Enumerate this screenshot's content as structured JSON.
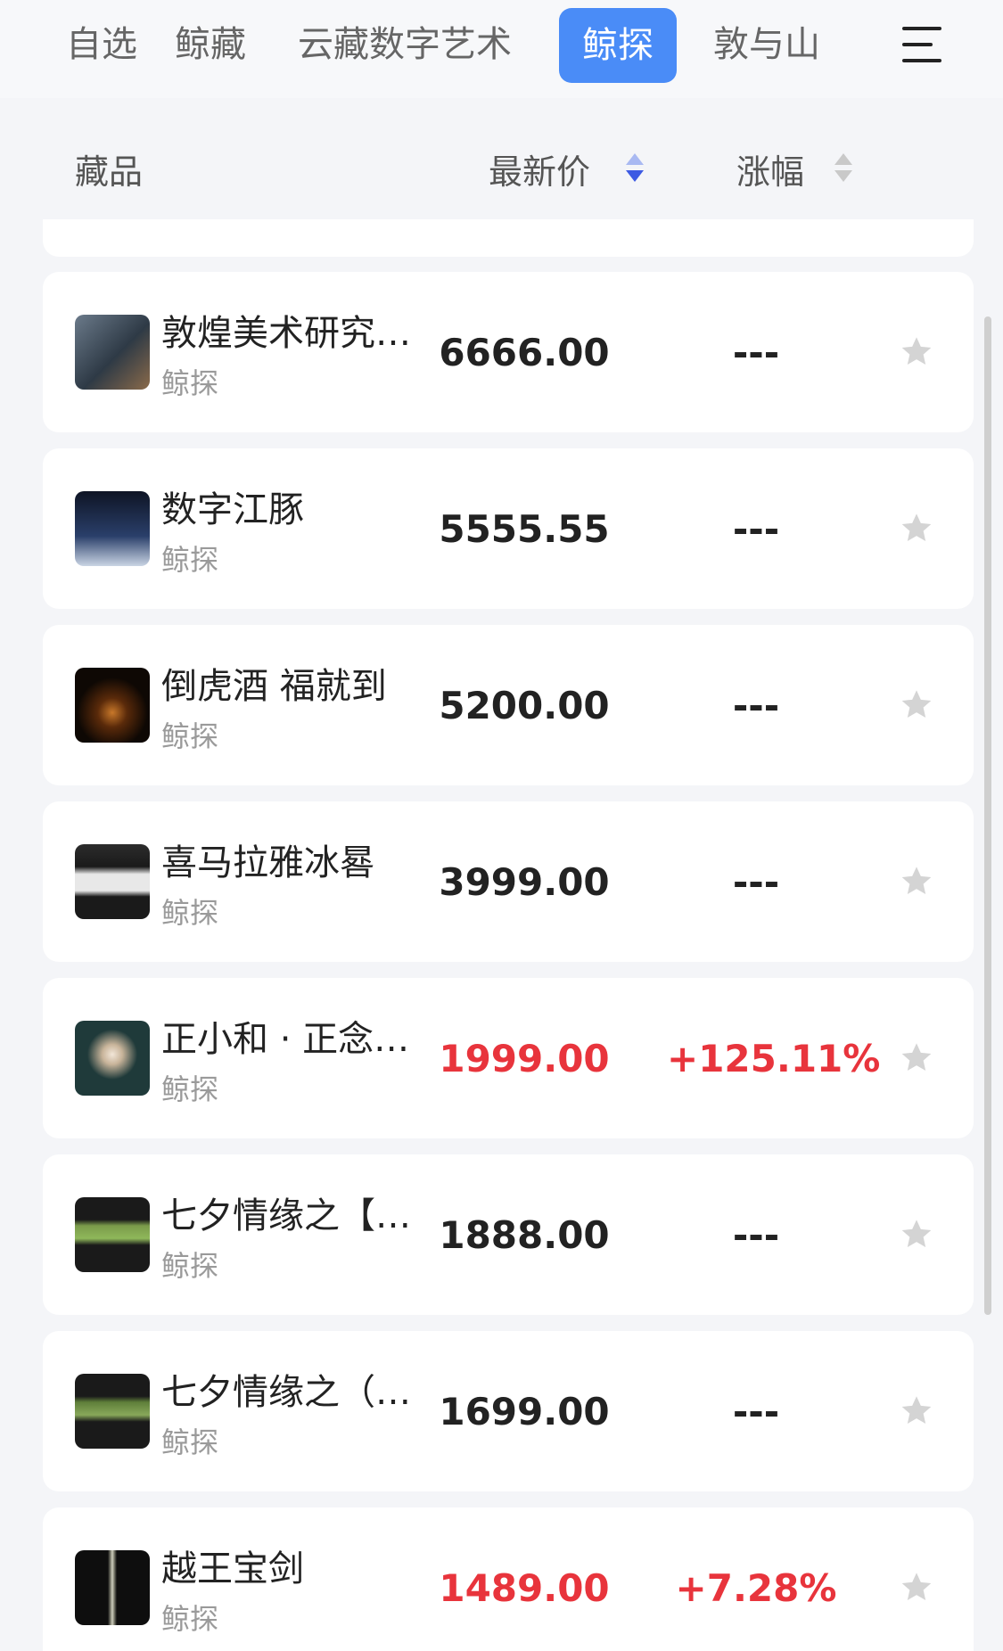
{
  "tabs": [
    {
      "label": "自选"
    },
    {
      "label": "鲸藏"
    },
    {
      "label": "云藏数字艺术"
    },
    {
      "label": "鲸探"
    },
    {
      "label": "敦与山"
    }
  ],
  "header": {
    "col_item": "藏品",
    "col_price": "最新价",
    "col_change": "涨幅"
  },
  "items": [
    {
      "name": "敦煌美术研究…",
      "platform": "鲸探",
      "price": "6666.00",
      "change": "---",
      "trend": "none",
      "thumb_color": "#4a5a6a"
    },
    {
      "name": "数字江豚",
      "platform": "鲸探",
      "price": "5555.55",
      "change": "---",
      "trend": "none",
      "thumb_color": "#1c2233"
    },
    {
      "name": "倒虎酒 福就到",
      "platform": "鲸探",
      "price": "5200.00",
      "change": "---",
      "trend": "none",
      "thumb_color": "#140c06"
    },
    {
      "name": "喜马拉雅冰晷",
      "platform": "鲸探",
      "price": "3999.00",
      "change": "---",
      "trend": "none",
      "thumb_color": "#2a2a2a"
    },
    {
      "name": "正小和 · 正念…",
      "platform": "鲸探",
      "price": "1999.00",
      "change": "+125.11%",
      "trend": "up",
      "thumb_color": "#1f3a3a"
    },
    {
      "name": "七夕情缘之【…",
      "platform": "鲸探",
      "price": "1888.00",
      "change": "---",
      "trend": "none",
      "thumb_color": "#1a1a1a"
    },
    {
      "name": "七夕情缘之（…",
      "platform": "鲸探",
      "price": "1699.00",
      "change": "---",
      "trend": "none",
      "thumb_color": "#1a1a1a"
    },
    {
      "name": "越王宝剑",
      "platform": "鲸探",
      "price": "1489.00",
      "change": "+7.28%",
      "trend": "up",
      "thumb_color": "#111111"
    }
  ],
  "icons": {
    "menu": "menu-icon",
    "star": "star-icon"
  },
  "colors": {
    "accent": "#4a8cf7",
    "up": "#e8343c"
  }
}
